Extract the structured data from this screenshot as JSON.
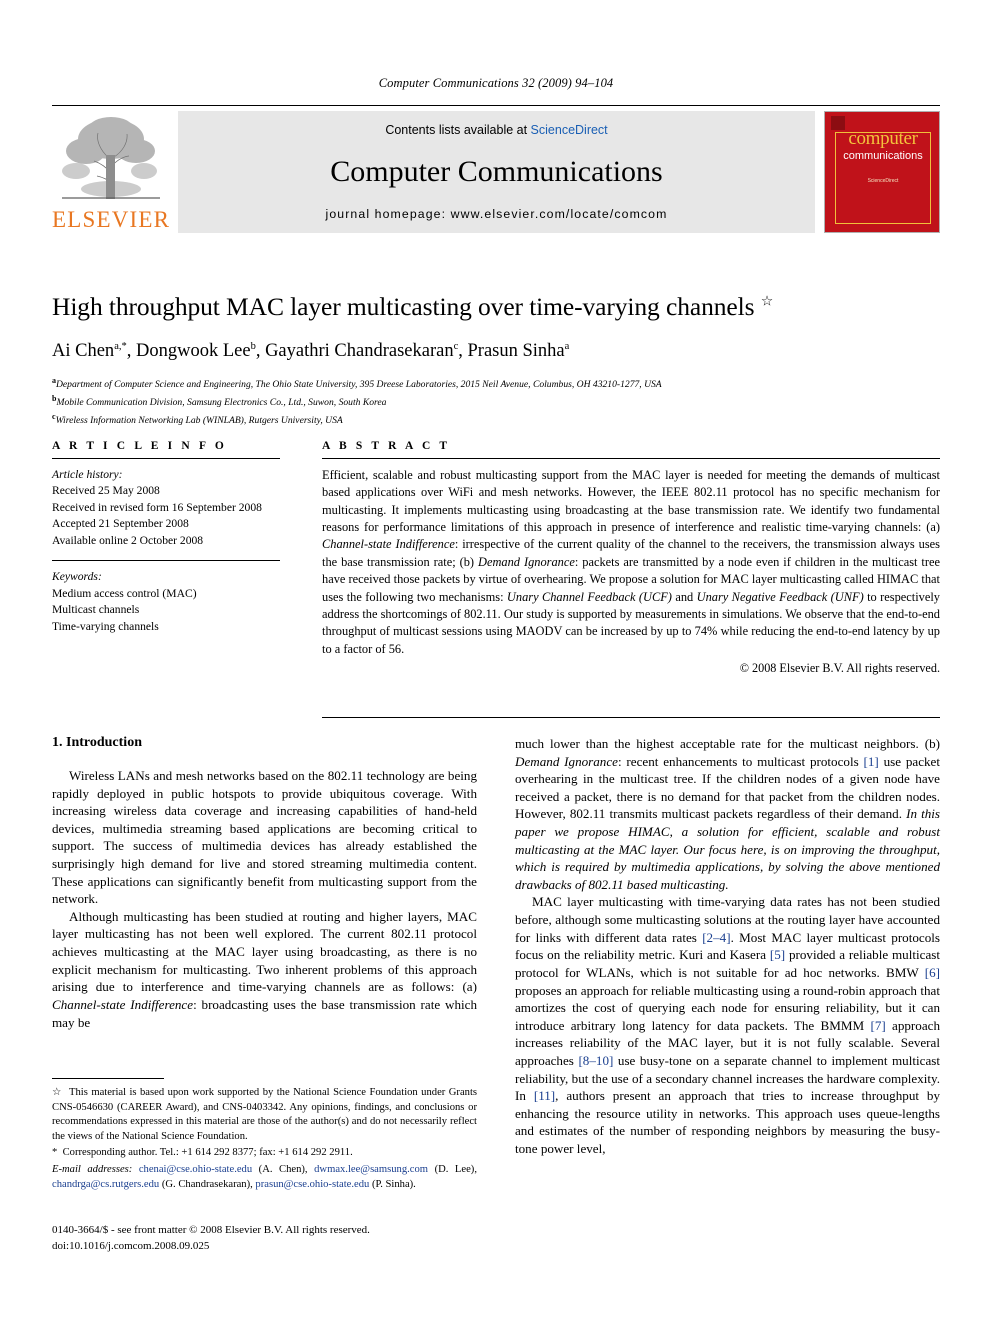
{
  "running_head": "Computer Communications 32 (2009) 94–104",
  "masthead": {
    "publisher_name": "ELSEVIER",
    "contents_prefix": "Contents lists available at ",
    "contents_link": "ScienceDirect",
    "journal_title": "Computer Communications",
    "homepage": "journal homepage: www.elsevier.com/locate/comcom",
    "cover": {
      "line1": "computer",
      "line2": "communications",
      "sciencedirect": "ScienceDirect"
    }
  },
  "article": {
    "title": "High throughput MAC layer multicasting over time-varying channels",
    "title_footnote_mark": "☆",
    "authors_html": "Ai Chen<sup>a,*</sup>, Dongwook Lee<sup>b</sup>, Gayathri Chandrasekaran<sup>c</sup>, Prasun Sinha<sup>a</sup>",
    "affiliations": [
      {
        "mark": "a",
        "text": "Department of Computer Science and Engineering, The Ohio State University, 395 Dreese Laboratories, 2015 Neil Avenue, Columbus, OH 43210-1277, USA"
      },
      {
        "mark": "b",
        "text": "Mobile Communication Division, Samsung Electronics Co., Ltd., Suwon, South Korea"
      },
      {
        "mark": "c",
        "text": "Wireless Information Networking Lab (WINLAB), Rutgers University, USA"
      }
    ]
  },
  "article_info": {
    "heading": "A R T I C L E   I N F O",
    "history_label": "Article history:",
    "history": [
      "Received 25 May 2008",
      "Received in revised form 16 September 2008",
      "Accepted 21 September 2008",
      "Available online 2 October 2008"
    ],
    "keywords_label": "Keywords:",
    "keywords": [
      "Medium access control (MAC)",
      "Multicast channels",
      "Time-varying channels"
    ]
  },
  "abstract": {
    "heading": "A B S T R A C T",
    "body_html": "Efficient, scalable and robust multicasting support from the MAC layer is needed for meeting the demands of multicast based applications over WiFi and mesh networks. However, the IEEE 802.11 protocol has no specific mechanism for multicasting. It implements multicasting using broadcasting at the base transmission rate. We identify two fundamental reasons for performance limitations of this approach in presence of interference and realistic time-varying channels: (a) <em>Channel-state Indifference</em>: irrespective of the current quality of the channel to the receivers, the transmission always uses the base transmission rate; (b) <em>Demand Ignorance</em>: packets are transmitted by a node even if children in the multicast tree have received those packets by virtue of overhearing. We propose a solution for MAC layer multicasting called HIMAC that uses the following two mechanisms: <em>Unary Channel Feedback (UCF)</em> and <em>Unary Negative Feedback (UNF)</em> to respectively address the shortcomings of 802.11. Our study is supported by measurements in simulations. We observe that the end-to-end throughput of multicast sessions using MAODV can be increased by up to 74% while reducing the end-to-end latency by up to a factor of 56.",
    "copyright": "© 2008 Elsevier B.V. All rights reserved."
  },
  "body": {
    "section_heading": "1. Introduction",
    "left_paragraphs_html": [
      "Wireless LANs and mesh networks based on the 802.11 technology are being rapidly deployed in public hotspots to provide ubiquitous coverage. With increasing wireless data coverage and increasing capabilities of hand-held devices, multimedia streaming based applications are becoming critical to support. The success of multimedia devices has already established the surprisingly high demand for live and stored streaming multimedia content. These applications can significantly benefit from multicasting support from the network.",
      "Although multicasting has been studied at routing and higher layers, MAC layer multicasting has not been well explored. The current 802.11 protocol achieves multicasting at the MAC layer using broadcasting, as there is no explicit mechanism for multicasting. Two inherent problems of this approach arising due to interference and time-varying channels are as follows: (a) <em>Channel-state Indifference</em>: broadcasting uses the base transmission rate which may be"
    ],
    "right_paragraphs_html": [
      "much lower than the highest acceptable rate for the multicast neighbors. (b) <em>Demand Ignorance</em>: recent enhancements to multicast protocols <span class=\"ref\">[1]</span> use packet overhearing in the multicast tree. If the children nodes of a given node have received a packet, there is no demand for that packet from the children nodes. However, 802.11 transmits multicast packets regardless of their demand. <em>In this paper we propose HIMAC, a solution for efficient, scalable and robust multicasting at the MAC layer. Our focus here, is on improving the throughput, which is required by multimedia applications, by solving the above mentioned drawbacks of 802.11 based multicasting.</em>",
      "MAC layer multicasting with time-varying data rates has not been studied before, although some multicasting solutions at the routing layer have accounted for links with different data rates <span class=\"ref\">[2–4]</span>. Most MAC layer multicast protocols focus on the reliability metric. Kuri and Kasera <span class=\"ref\">[5]</span> provided a reliable multicast protocol for WLANs, which is not suitable for ad hoc networks. BMW <span class=\"ref\">[6]</span> proposes an approach for reliable multicasting using a round-robin approach that amortizes the cost of querying each node for ensuring reliability, but it can introduce arbitrary long latency for data packets. The BMMM <span class=\"ref\">[7]</span> approach increases reliability of the MAC layer, but it is not fully scalable. Several approaches <span class=\"ref\">[8–10]</span> use busy-tone on a separate channel to implement multicast reliability, but the use of a secondary channel increases the hardware complexity. In <span class=\"ref\">[11]</span>, authors present an approach that tries to increase throughput by enhancing the resource utility in networks. This approach uses queue-lengths and estimates of the number of responding neighbors by measuring the busy-tone power level,"
    ]
  },
  "footnotes": {
    "funding_html": "<span class=\"mark\">☆</span>&nbsp; This material is based upon work supported by the National Science Foundation under Grants CNS-0546630 (CAREER Award), and CNS-0403342. Any opinions, findings, and conclusions or recommendations expressed in this material are those of the author(s) and do not necessarily reflect the views of the National Science Foundation.",
    "corresponding_html": "<span class=\"mark\">*</span>&nbsp; Corresponding author. Tel.: +1 614 292 8377; fax: +1 614 292 2911.",
    "emails_html": "<em>E-mail addresses:</em> <span class=\"mail\">chenai@cse.ohio-state.edu</span> (A. Chen), <span class=\"mail\">dwmax.lee@samsung.com</span> (D. Lee), <span class=\"mail\">chandrga@cs.rutgers.edu</span> (G. Chandrasekaran), <span class=\"mail\">prasun@cse.ohio-state.edu</span> (P. Sinha)."
  },
  "page_footer": {
    "issn_line": "0140-3664/$ - see front matter © 2008 Elsevier B.V. All rights reserved.",
    "doi_line": "doi:10.1016/j.comcom.2008.09.025"
  },
  "colors": {
    "link_blue": "#1a5fb4",
    "ref_blue": "#1a3f8f",
    "elsevier_orange": "#E87722",
    "cover_red": "#c0121a",
    "cover_yellow": "#f3c33c",
    "band_gray": "#e7e7e7"
  }
}
